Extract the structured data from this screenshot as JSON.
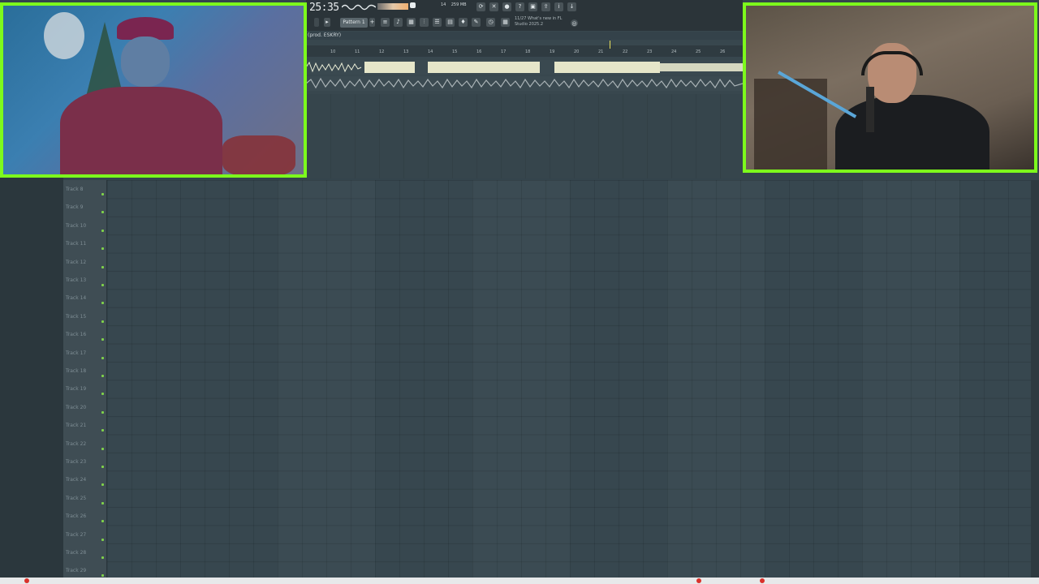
{
  "daw": {
    "time": "25:35",
    "memory": "259 MB",
    "cpu": "14",
    "pattern_label": "Pattern 1",
    "news_line1": "11/27 What's new in FL",
    "news_line2": "Studio 2025.2",
    "song_title": "(prod. ESKRY)",
    "bar_numbers": [
      "10",
      "11",
      "12",
      "13",
      "14",
      "15",
      "16",
      "17",
      "18",
      "19",
      "20",
      "21",
      "22",
      "23",
      "24",
      "25",
      "26"
    ]
  },
  "tracks": [
    "Track 8",
    "Track 9",
    "Track 10",
    "Track 11",
    "Track 12",
    "Track 13",
    "Track 14",
    "Track 15",
    "Track 16",
    "Track 17",
    "Track 18",
    "Track 19",
    "Track 20",
    "Track 21",
    "Track 22",
    "Track 23",
    "Track 24",
    "Track 25",
    "Track 26",
    "Track 27",
    "Track 28",
    "Track 29"
  ],
  "colors": {
    "cam_border": "#7dfa1c",
    "grid_bg": "#37474f",
    "track_led": "#7fd24a",
    "playhead": "#e9e05a"
  },
  "icons": [
    "loop-icon",
    "cut-icon",
    "mic-icon",
    "help-icon",
    "save-icon",
    "export-icon",
    "info-icon",
    "download-icon",
    "mixer-icon",
    "channel-rack-icon",
    "piano-roll-icon",
    "browser-icon",
    "plugin-icon",
    "snap-icon",
    "globe-icon"
  ]
}
